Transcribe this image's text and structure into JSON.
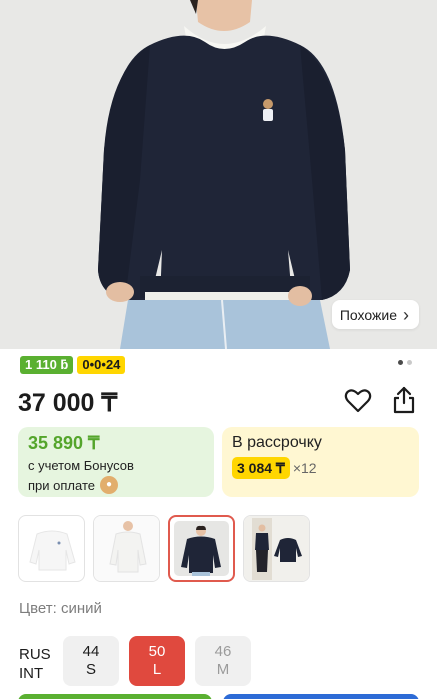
{
  "photo": {
    "similar_label": "Похожие"
  },
  "badges": {
    "bonus": "1 110 ƃ",
    "installment": "0•0•24"
  },
  "carousel": {
    "pages": 2,
    "active": 1
  },
  "price": {
    "value": "37 000 ₸"
  },
  "bonus_card": {
    "amount": "35 890 ₸",
    "line1": "с учетом Бонусов",
    "line2": "при оплате"
  },
  "install_card": {
    "title": "В рассрочку",
    "monthly": "3 084 ₸",
    "multiplier": "×12"
  },
  "colors": {
    "label": "Цвет: синий"
  },
  "sizes": {
    "system_top": "RUS",
    "system_bottom": "INT",
    "items": [
      {
        "rus": "44",
        "int": "S"
      },
      {
        "rus": "50",
        "int": "L"
      },
      {
        "rus": "46",
        "int": "M"
      }
    ]
  },
  "theme": {
    "green": "#5ab031",
    "yellow": "#ffd600",
    "red": "#e0493e",
    "blue": "#2d6bd6"
  }
}
